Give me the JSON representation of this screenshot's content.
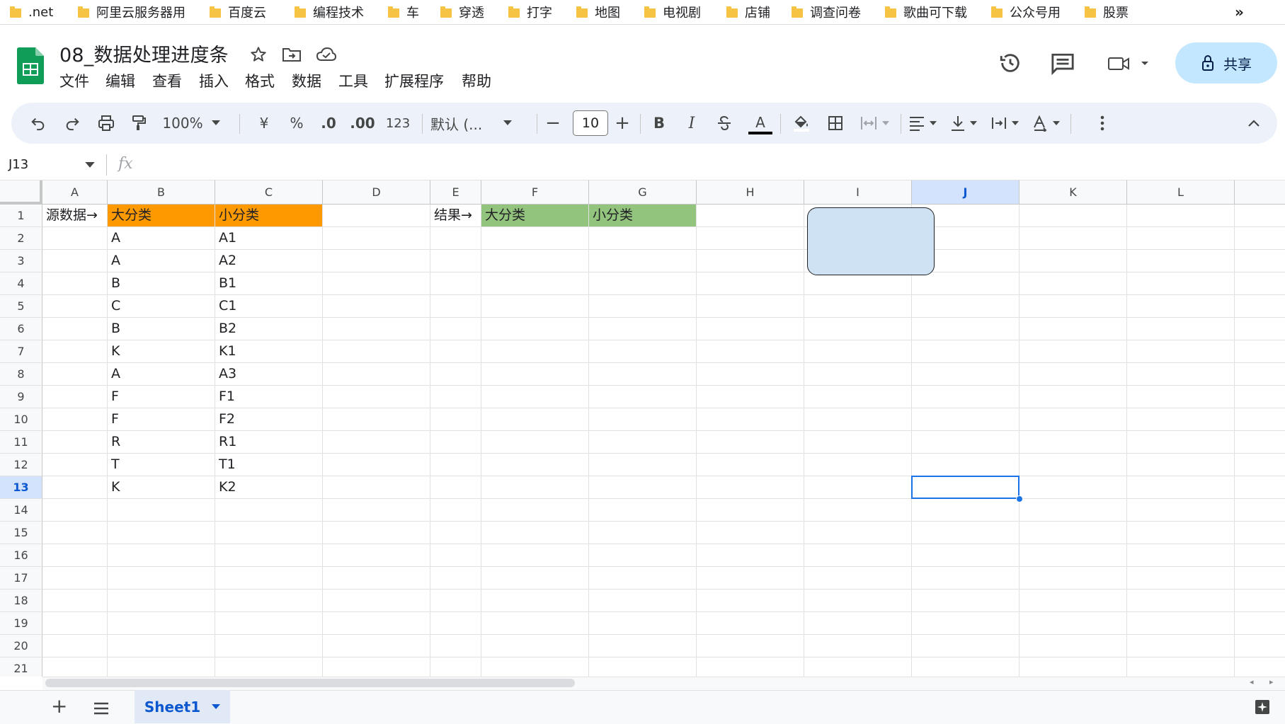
{
  "bookmarks": [
    ".net",
    "阿里云服务器用",
    "百度云",
    "编程技术",
    "车",
    "穿透",
    "打字",
    "地图",
    "电视剧",
    "店铺",
    "调查问卷",
    "歌曲可下载",
    "公众号用",
    "股票"
  ],
  "bookmarks_more": "»",
  "doc": {
    "title": "08_数据处理进度条"
  },
  "menu": [
    "文件",
    "编辑",
    "查看",
    "插入",
    "格式",
    "数据",
    "工具",
    "扩展程序",
    "帮助"
  ],
  "share_label": "共享",
  "toolbar": {
    "zoom": "100%",
    "currency": "¥",
    "percent": "%",
    "dec_decrease": ".0",
    "dec_increase": ".00",
    "number_format": "123",
    "font": "默认 (...",
    "font_size": "10",
    "bold": "B",
    "italic": "I",
    "text_color": "A"
  },
  "formula_bar": {
    "cell_ref": "J13",
    "fx": "fx",
    "value": ""
  },
  "columns": [
    "A",
    "B",
    "C",
    "D",
    "E",
    "F",
    "G",
    "H",
    "I",
    "J",
    "K",
    "L"
  ],
  "rows": [
    "1",
    "2",
    "3",
    "4",
    "5",
    "6",
    "7",
    "8",
    "9",
    "10",
    "11",
    "12",
    "13",
    "14",
    "15",
    "16",
    "17",
    "18",
    "19",
    "20",
    "21"
  ],
  "selected": {
    "column": "J",
    "row": "13"
  },
  "cells": {
    "A1": "源数据→",
    "B1": "大分类",
    "C1": "小分类",
    "E1": "结果→",
    "F1": "大分类",
    "G1": "小分类",
    "B2": "A",
    "C2": "A1",
    "B3": "A",
    "C3": "A2",
    "B4": "B",
    "C4": "B1",
    "B5": "C",
    "C5": "C1",
    "B6": "B",
    "C6": "B2",
    "B7": "K",
    "C7": "K1",
    "B8": "A",
    "C8": "A3",
    "B9": "F",
    "C9": "F1",
    "B10": "F",
    "C10": "F2",
    "B11": "R",
    "C11": "R1",
    "B12": "T",
    "C12": "T1",
    "B13": "K",
    "C13": "K2"
  },
  "fills": {
    "source_header": "#ff9900",
    "result_header": "#93c47d",
    "shape": "#cfe2f3",
    "selection": "#1a73e8"
  },
  "sheet_tab": "Sheet1"
}
